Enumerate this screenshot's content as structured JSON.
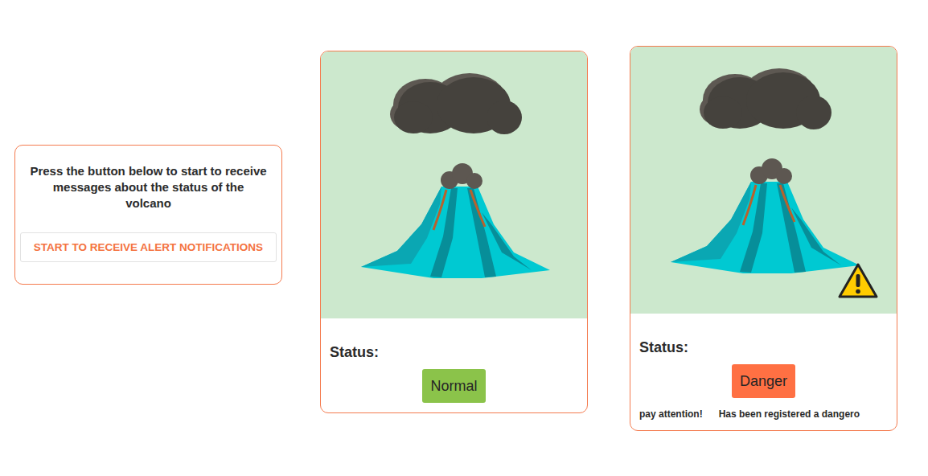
{
  "intro": {
    "message": "Press the button below to start to receive messages about the status of the volcano",
    "button": "START TO RECEIVE ALERT NOTIFICATIONS"
  },
  "cards": [
    {
      "status_label": "Status:",
      "status": "Normal",
      "color": "#8bc34a",
      "warning": false,
      "notice": []
    },
    {
      "status_label": "Status:",
      "status": "Danger",
      "color": "#ff7043",
      "warning": true,
      "notice": [
        "pay attention!",
        "Has been registered a dangero"
      ]
    }
  ]
}
